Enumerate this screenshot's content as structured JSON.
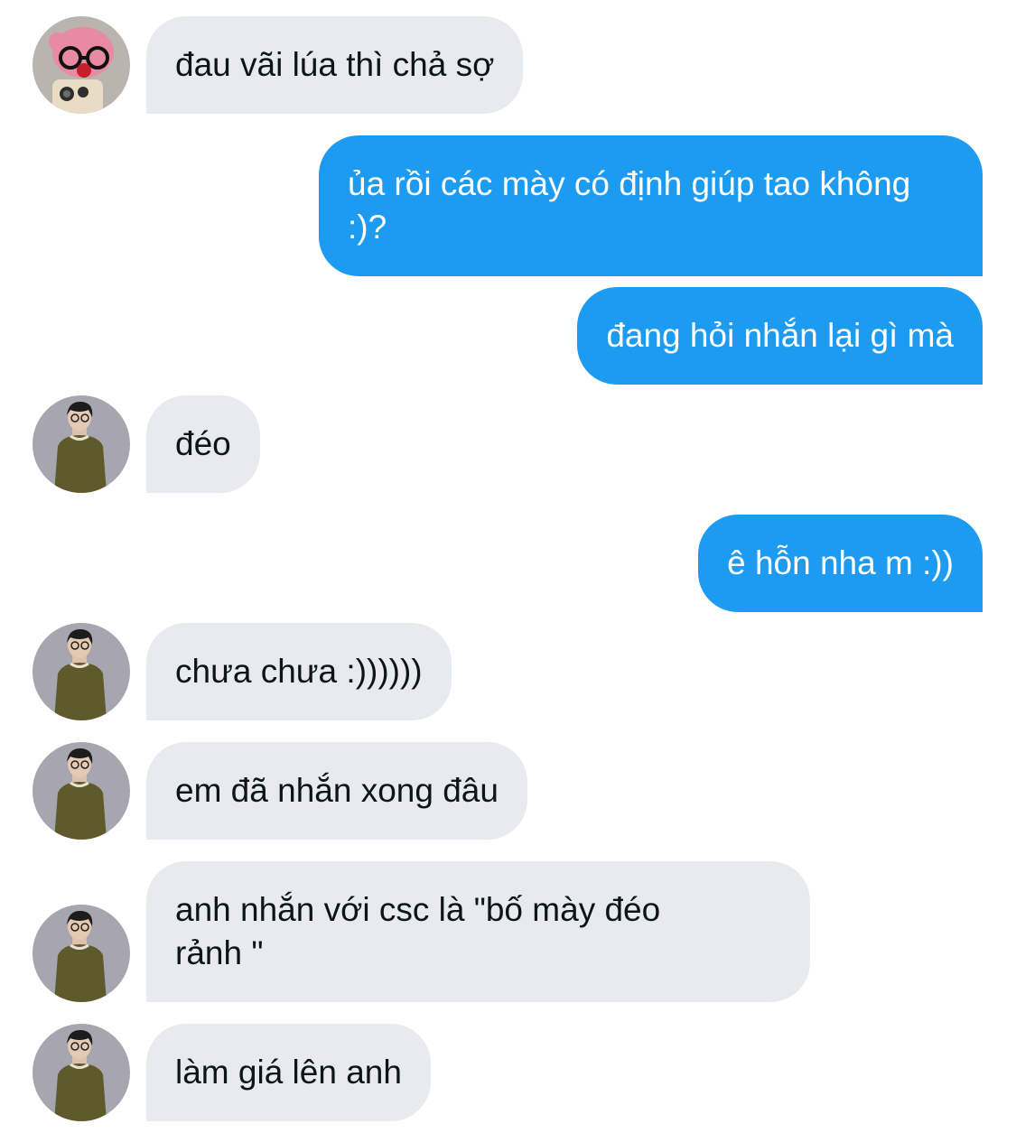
{
  "conversation": {
    "messages": [
      {
        "sender": "other-pink",
        "text": "đau vãi lúa thì chả sợ"
      },
      {
        "sender": "me",
        "text": "ủa rồi các mày có định giúp tao không :)?"
      },
      {
        "sender": "me",
        "text": "đang hỏi nhắn lại gì mà"
      },
      {
        "sender": "other-man",
        "text": "đéo"
      },
      {
        "sender": "me",
        "text": "ê hỗn nha m :))"
      },
      {
        "sender": "other-man",
        "text": "chưa chưa :))))))"
      },
      {
        "sender": "other-man",
        "text": "em đã nhắn xong đâu"
      },
      {
        "sender": "other-man",
        "text": "anh nhắn với csc là \"bố mày đéo\nrảnh \""
      },
      {
        "sender": "other-man",
        "text": "làm giá lên anh"
      }
    ]
  },
  "colors": {
    "outgoing_bubble": "#1d9bf0",
    "incoming_bubble": "#e7ebef",
    "incoming_text": "#0f1419",
    "outgoing_text": "#ffffff"
  },
  "avatars": {
    "pink": "pink-plush-with-glasses-avatar-icon",
    "man": "man-in-olive-tshirt-avatar-icon"
  }
}
